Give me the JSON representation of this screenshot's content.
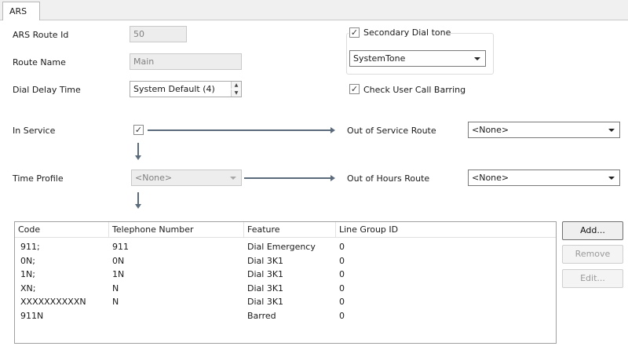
{
  "tab": {
    "label": "ARS"
  },
  "form": {
    "route_id": {
      "label": "ARS Route Id",
      "value": "50"
    },
    "route_name": {
      "label": "Route Name",
      "value": "Main"
    },
    "dial_delay": {
      "label": "Dial Delay Time",
      "value": "System Default (4)"
    },
    "secondary_dial_tone": {
      "label": "Secondary Dial tone",
      "checked": true,
      "selected": "SystemTone"
    },
    "check_barring": {
      "label": "Check User Call Barring",
      "checked": true
    },
    "in_service": {
      "label": "In Service",
      "checked": true
    },
    "out_of_service": {
      "label": "Out of Service Route",
      "selected": "<None>"
    },
    "time_profile": {
      "label": "Time Profile",
      "selected": "<None>"
    },
    "out_of_hours": {
      "label": "Out of Hours Route",
      "selected": "<None>"
    }
  },
  "table": {
    "columns": [
      "Code",
      "Telephone Number",
      "Feature",
      "Line Group ID"
    ],
    "rows": [
      [
        "911;",
        "911",
        "Dial Emergency",
        "0"
      ],
      [
        "0N;",
        "0N",
        "Dial 3K1",
        "0"
      ],
      [
        "1N;",
        "1N",
        "Dial 3K1",
        "0"
      ],
      [
        "XN;",
        "N",
        "Dial 3K1",
        "0"
      ],
      [
        "XXXXXXXXXXN",
        "N",
        "Dial 3K1",
        "0"
      ],
      [
        "911N",
        "",
        "Barred",
        "0"
      ]
    ]
  },
  "buttons": {
    "add": "Add...",
    "remove": "Remove",
    "edit": "Edit..."
  },
  "icons": {
    "checkmark": "checkmark-icon",
    "dropdown": "chevron-down-icon",
    "arrow": "arrow-icon"
  }
}
